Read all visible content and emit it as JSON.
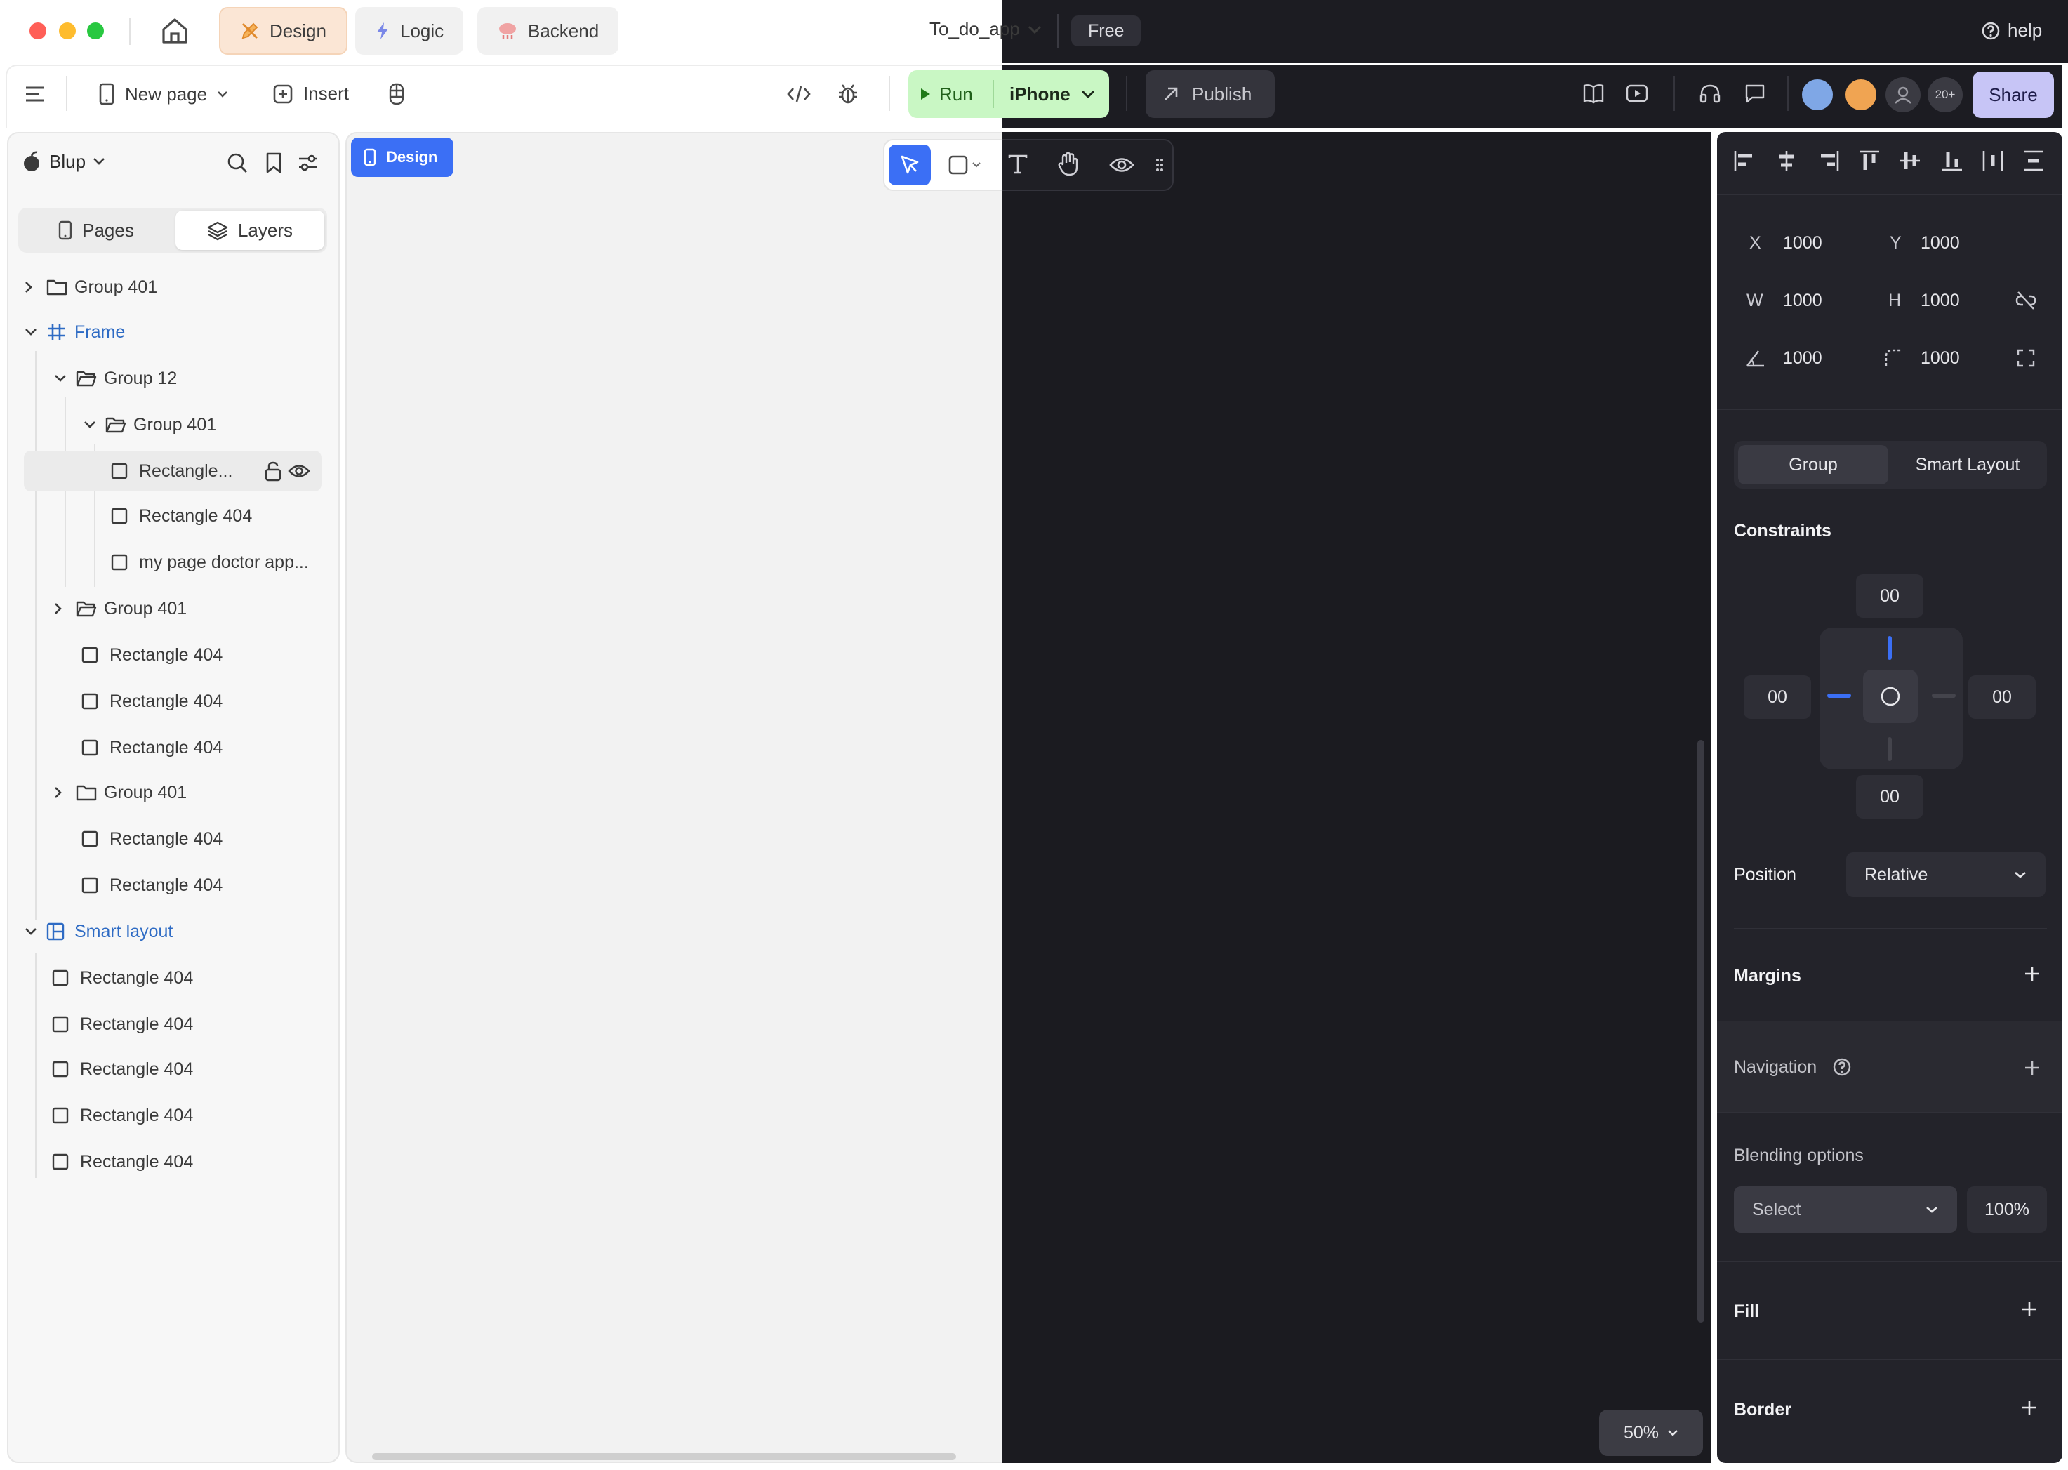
{
  "window": {
    "mode_tabs": [
      {
        "label": "Design",
        "active": true
      },
      {
        "label": "Logic",
        "active": false
      },
      {
        "label": "Backend",
        "active": false
      }
    ],
    "project_name": "To_do_app",
    "plan_badge": "Free",
    "help_label": "help"
  },
  "toolbar": {
    "new_page_label": "New page",
    "insert_label": "Insert",
    "run_label": "Run",
    "device_label": "iPhone",
    "publish_label": "Publish",
    "collaborators_more": "20+",
    "share_label": "Share"
  },
  "left_panel": {
    "workspace_name": "Blup",
    "tabs": {
      "pages": "Pages",
      "layers": "Layers",
      "active": "Layers"
    },
    "layers": [
      {
        "label": "Group 401",
        "type": "folder",
        "expanded": false,
        "depth": 0
      },
      {
        "label": "Frame",
        "type": "frame",
        "expanded": true,
        "depth": 0
      },
      {
        "label": "Group 12",
        "type": "folder-open",
        "expanded": true,
        "depth": 1
      },
      {
        "label": "Group 401",
        "type": "folder-open",
        "expanded": true,
        "depth": 2
      },
      {
        "label": "Rectangle...",
        "type": "rect",
        "depth": 3,
        "selected": true
      },
      {
        "label": "Rectangle 404",
        "type": "rect",
        "depth": 3
      },
      {
        "label": "my page doctor app...",
        "type": "rect",
        "depth": 3
      },
      {
        "label": "Group 401",
        "type": "folder-open",
        "expanded": false,
        "depth": 1
      },
      {
        "label": "Rectangle 404",
        "type": "rect",
        "depth": 1
      },
      {
        "label": "Rectangle 404",
        "type": "rect",
        "depth": 1
      },
      {
        "label": "Rectangle 404",
        "type": "rect",
        "depth": 1
      },
      {
        "label": "Group 401",
        "type": "folder",
        "expanded": false,
        "depth": 1
      },
      {
        "label": "Rectangle 404",
        "type": "rect",
        "depth": 1
      },
      {
        "label": "Rectangle 404",
        "type": "rect",
        "depth": 1
      },
      {
        "label": "Smart layout",
        "type": "smart",
        "expanded": true,
        "depth": 0
      },
      {
        "label": "Rectangle 404",
        "type": "rect",
        "depth": 0
      },
      {
        "label": "Rectangle 404",
        "type": "rect",
        "depth": 0
      },
      {
        "label": "Rectangle 404",
        "type": "rect",
        "depth": 0
      },
      {
        "label": "Rectangle 404",
        "type": "rect",
        "depth": 0
      },
      {
        "label": "Rectangle 404",
        "type": "rect",
        "depth": 0
      }
    ]
  },
  "canvas": {
    "frame_tag": "Design",
    "zoom_label": "50%"
  },
  "right_panel": {
    "transform": {
      "x_label": "X",
      "x_value": "1000",
      "y_label": "Y",
      "y_value": "1000",
      "w_label": "W",
      "w_value": "1000",
      "h_label": "H",
      "h_value": "1000",
      "rotation_value": "1000",
      "radius_value": "1000"
    },
    "layout_tabs": {
      "group": "Group",
      "smart_layout": "Smart Layout"
    },
    "constraints": {
      "title": "Constraints",
      "top": "00",
      "left": "00",
      "right": "00",
      "bottom": "00"
    },
    "position": {
      "label": "Position",
      "value": "Relative"
    },
    "margins_label": "Margins",
    "navigation_label": "Navigation",
    "blending": {
      "label": "Blending options",
      "select_value": "Select",
      "opacity": "100%"
    },
    "fill_label": "Fill",
    "border_label": "Border"
  },
  "colors": {
    "accent_blue": "#3b6ff5",
    "run_green": "#c9f7c4",
    "share_lavender": "#c7c5f6",
    "dark_bg": "#1c1c22"
  }
}
